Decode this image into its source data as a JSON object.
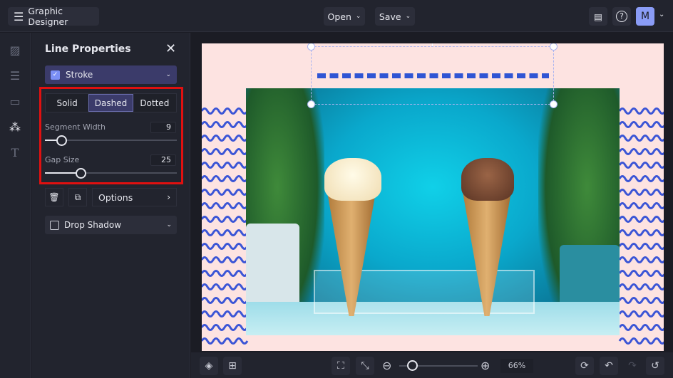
{
  "app": {
    "title": "Graphic Designer",
    "menu_icon": "hamburger-icon"
  },
  "topbar": {
    "open_label": "Open",
    "save_label": "Save",
    "avatar_initial": "M",
    "accent": "#8a9cf6"
  },
  "panel": {
    "title": "Line Properties",
    "stroke_label": "Stroke",
    "stroke_checked": true,
    "styles": [
      "Solid",
      "Dashed",
      "Dotted"
    ],
    "selected_style": "Dashed",
    "segment_width_label": "Segment Width",
    "segment_width": "9",
    "gap_size_label": "Gap Size",
    "gap_size": "25",
    "options_label": "Options",
    "drop_shadow_label": "Drop Shadow",
    "drop_shadow_checked": false
  },
  "zoom": {
    "level": "66%"
  },
  "colors": {
    "highlight": "#e01010",
    "line": "#2f55d4",
    "page": "#fde3e1"
  }
}
